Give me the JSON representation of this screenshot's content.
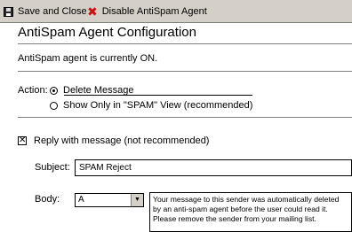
{
  "toolbar": {
    "save_label": "Save and Close",
    "disable_label": "Disable AntiSpam Agent",
    "save_icon": "floppy-disk-icon",
    "disable_icon": "red-x-icon"
  },
  "title": "AntiSpam Agent Configuration",
  "status": "AntiSpam agent is currently ON.",
  "action": {
    "label": "Action:",
    "options": [
      {
        "label": "Delete Message",
        "selected": true
      },
      {
        "label": "Show Only in \"SPAM\" View (recommended)",
        "selected": false
      }
    ]
  },
  "reply": {
    "checked": true,
    "label": "Reply with message (not recommended)"
  },
  "subject": {
    "label": "Subject:",
    "value": "SPAM Reject"
  },
  "body": {
    "label": "Body:",
    "select_value": "A",
    "text": "Your message to this sender was automatically deleted by an anti-spam agent before the user could read it.  Please remove the sender from your mailing list."
  },
  "colors": {
    "toolbar_bg": "#d4d0c8",
    "disable_icon": "#cc1111"
  }
}
